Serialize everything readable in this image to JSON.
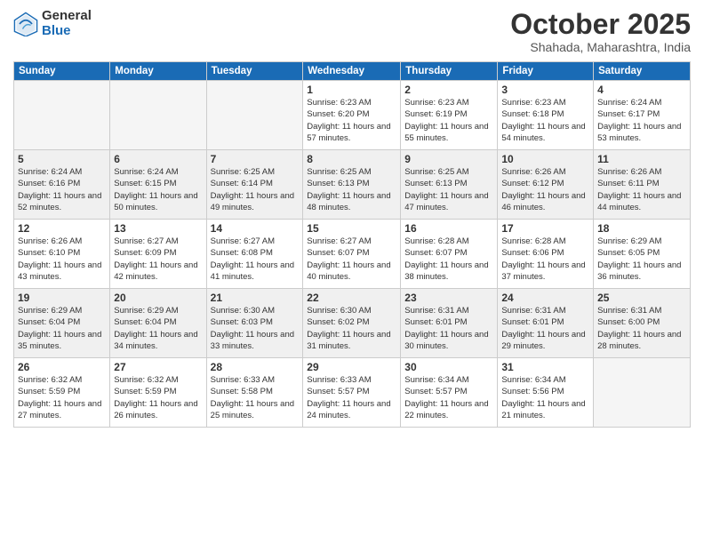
{
  "header": {
    "logo_general": "General",
    "logo_blue": "Blue",
    "month": "October 2025",
    "location": "Shahada, Maharashtra, India"
  },
  "weekdays": [
    "Sunday",
    "Monday",
    "Tuesday",
    "Wednesday",
    "Thursday",
    "Friday",
    "Saturday"
  ],
  "weeks": [
    [
      {
        "day": "",
        "sunrise": "",
        "sunset": "",
        "daylight": ""
      },
      {
        "day": "",
        "sunrise": "",
        "sunset": "",
        "daylight": ""
      },
      {
        "day": "",
        "sunrise": "",
        "sunset": "",
        "daylight": ""
      },
      {
        "day": "1",
        "sunrise": "Sunrise: 6:23 AM",
        "sunset": "Sunset: 6:20 PM",
        "daylight": "Daylight: 11 hours and 57 minutes."
      },
      {
        "day": "2",
        "sunrise": "Sunrise: 6:23 AM",
        "sunset": "Sunset: 6:19 PM",
        "daylight": "Daylight: 11 hours and 55 minutes."
      },
      {
        "day": "3",
        "sunrise": "Sunrise: 6:23 AM",
        "sunset": "Sunset: 6:18 PM",
        "daylight": "Daylight: 11 hours and 54 minutes."
      },
      {
        "day": "4",
        "sunrise": "Sunrise: 6:24 AM",
        "sunset": "Sunset: 6:17 PM",
        "daylight": "Daylight: 11 hours and 53 minutes."
      }
    ],
    [
      {
        "day": "5",
        "sunrise": "Sunrise: 6:24 AM",
        "sunset": "Sunset: 6:16 PM",
        "daylight": "Daylight: 11 hours and 52 minutes."
      },
      {
        "day": "6",
        "sunrise": "Sunrise: 6:24 AM",
        "sunset": "Sunset: 6:15 PM",
        "daylight": "Daylight: 11 hours and 50 minutes."
      },
      {
        "day": "7",
        "sunrise": "Sunrise: 6:25 AM",
        "sunset": "Sunset: 6:14 PM",
        "daylight": "Daylight: 11 hours and 49 minutes."
      },
      {
        "day": "8",
        "sunrise": "Sunrise: 6:25 AM",
        "sunset": "Sunset: 6:13 PM",
        "daylight": "Daylight: 11 hours and 48 minutes."
      },
      {
        "day": "9",
        "sunrise": "Sunrise: 6:25 AM",
        "sunset": "Sunset: 6:13 PM",
        "daylight": "Daylight: 11 hours and 47 minutes."
      },
      {
        "day": "10",
        "sunrise": "Sunrise: 6:26 AM",
        "sunset": "Sunset: 6:12 PM",
        "daylight": "Daylight: 11 hours and 46 minutes."
      },
      {
        "day": "11",
        "sunrise": "Sunrise: 6:26 AM",
        "sunset": "Sunset: 6:11 PM",
        "daylight": "Daylight: 11 hours and 44 minutes."
      }
    ],
    [
      {
        "day": "12",
        "sunrise": "Sunrise: 6:26 AM",
        "sunset": "Sunset: 6:10 PM",
        "daylight": "Daylight: 11 hours and 43 minutes."
      },
      {
        "day": "13",
        "sunrise": "Sunrise: 6:27 AM",
        "sunset": "Sunset: 6:09 PM",
        "daylight": "Daylight: 11 hours and 42 minutes."
      },
      {
        "day": "14",
        "sunrise": "Sunrise: 6:27 AM",
        "sunset": "Sunset: 6:08 PM",
        "daylight": "Daylight: 11 hours and 41 minutes."
      },
      {
        "day": "15",
        "sunrise": "Sunrise: 6:27 AM",
        "sunset": "Sunset: 6:07 PM",
        "daylight": "Daylight: 11 hours and 40 minutes."
      },
      {
        "day": "16",
        "sunrise": "Sunrise: 6:28 AM",
        "sunset": "Sunset: 6:07 PM",
        "daylight": "Daylight: 11 hours and 38 minutes."
      },
      {
        "day": "17",
        "sunrise": "Sunrise: 6:28 AM",
        "sunset": "Sunset: 6:06 PM",
        "daylight": "Daylight: 11 hours and 37 minutes."
      },
      {
        "day": "18",
        "sunrise": "Sunrise: 6:29 AM",
        "sunset": "Sunset: 6:05 PM",
        "daylight": "Daylight: 11 hours and 36 minutes."
      }
    ],
    [
      {
        "day": "19",
        "sunrise": "Sunrise: 6:29 AM",
        "sunset": "Sunset: 6:04 PM",
        "daylight": "Daylight: 11 hours and 35 minutes."
      },
      {
        "day": "20",
        "sunrise": "Sunrise: 6:29 AM",
        "sunset": "Sunset: 6:04 PM",
        "daylight": "Daylight: 11 hours and 34 minutes."
      },
      {
        "day": "21",
        "sunrise": "Sunrise: 6:30 AM",
        "sunset": "Sunset: 6:03 PM",
        "daylight": "Daylight: 11 hours and 33 minutes."
      },
      {
        "day": "22",
        "sunrise": "Sunrise: 6:30 AM",
        "sunset": "Sunset: 6:02 PM",
        "daylight": "Daylight: 11 hours and 31 minutes."
      },
      {
        "day": "23",
        "sunrise": "Sunrise: 6:31 AM",
        "sunset": "Sunset: 6:01 PM",
        "daylight": "Daylight: 11 hours and 30 minutes."
      },
      {
        "day": "24",
        "sunrise": "Sunrise: 6:31 AM",
        "sunset": "Sunset: 6:01 PM",
        "daylight": "Daylight: 11 hours and 29 minutes."
      },
      {
        "day": "25",
        "sunrise": "Sunrise: 6:31 AM",
        "sunset": "Sunset: 6:00 PM",
        "daylight": "Daylight: 11 hours and 28 minutes."
      }
    ],
    [
      {
        "day": "26",
        "sunrise": "Sunrise: 6:32 AM",
        "sunset": "Sunset: 5:59 PM",
        "daylight": "Daylight: 11 hours and 27 minutes."
      },
      {
        "day": "27",
        "sunrise": "Sunrise: 6:32 AM",
        "sunset": "Sunset: 5:59 PM",
        "daylight": "Daylight: 11 hours and 26 minutes."
      },
      {
        "day": "28",
        "sunrise": "Sunrise: 6:33 AM",
        "sunset": "Sunset: 5:58 PM",
        "daylight": "Daylight: 11 hours and 25 minutes."
      },
      {
        "day": "29",
        "sunrise": "Sunrise: 6:33 AM",
        "sunset": "Sunset: 5:57 PM",
        "daylight": "Daylight: 11 hours and 24 minutes."
      },
      {
        "day": "30",
        "sunrise": "Sunrise: 6:34 AM",
        "sunset": "Sunset: 5:57 PM",
        "daylight": "Daylight: 11 hours and 22 minutes."
      },
      {
        "day": "31",
        "sunrise": "Sunrise: 6:34 AM",
        "sunset": "Sunset: 5:56 PM",
        "daylight": "Daylight: 11 hours and 21 minutes."
      },
      {
        "day": "",
        "sunrise": "",
        "sunset": "",
        "daylight": ""
      }
    ]
  ]
}
